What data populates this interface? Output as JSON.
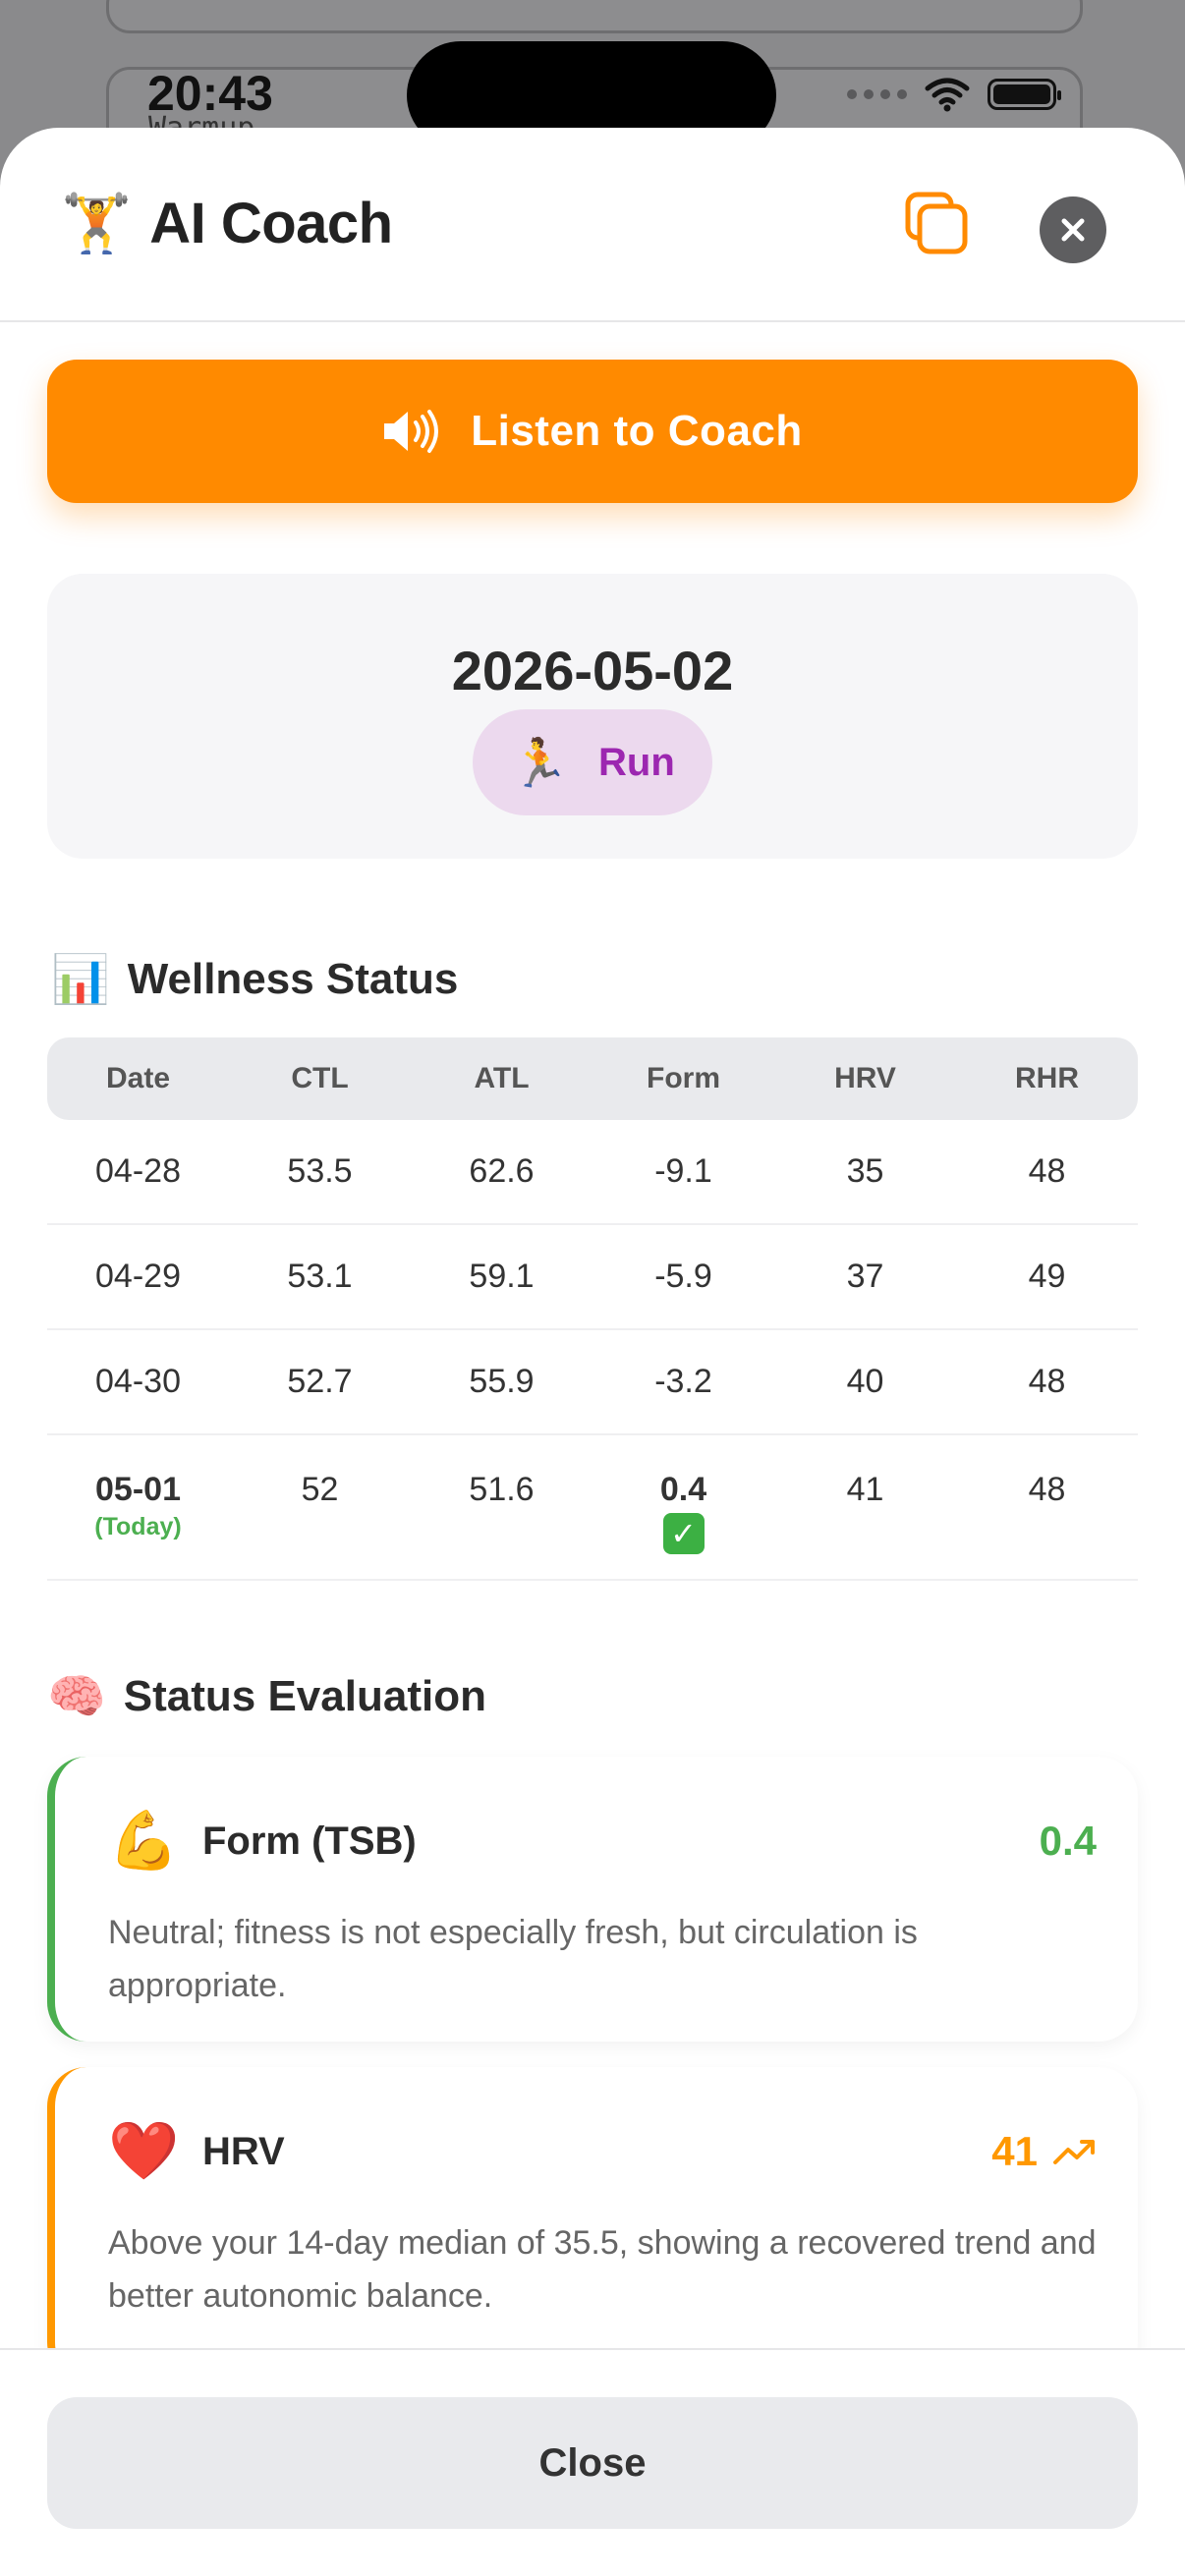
{
  "status_bar": {
    "time": "20:43"
  },
  "background": {
    "card_text": "Warmup"
  },
  "header": {
    "emoji": "🏋️",
    "title": "AI Coach"
  },
  "listen_button": {
    "label": "Listen to Coach"
  },
  "date_card": {
    "date": "2026-05-02",
    "sport_emoji": "🏃",
    "sport": "Run"
  },
  "wellness": {
    "title_emoji": "📊",
    "title": "Wellness Status",
    "columns": [
      "Date",
      "CTL",
      "ATL",
      "Form",
      "HRV",
      "RHR"
    ],
    "rows": [
      {
        "date": "04-28",
        "ctl": "53.5",
        "atl": "62.6",
        "form": "-9.1",
        "hrv": "35",
        "rhr": "48"
      },
      {
        "date": "04-29",
        "ctl": "53.1",
        "atl": "59.1",
        "form": "-5.9",
        "hrv": "37",
        "rhr": "49"
      },
      {
        "date": "04-30",
        "ctl": "52.7",
        "atl": "55.9",
        "form": "-3.2",
        "hrv": "40",
        "rhr": "48"
      }
    ],
    "today": {
      "date": "05-01",
      "label": "(Today)",
      "ctl": "52",
      "atl": "51.6",
      "form": "0.4",
      "hrv": "41",
      "rhr": "48"
    }
  },
  "evaluation": {
    "title_emoji": "🧠",
    "title": "Status Evaluation",
    "items": [
      {
        "emoji": "💪",
        "name": "Form (TSB)",
        "value": "0.4",
        "color": "#4caf50",
        "desc": "Neutral; fitness is not especially fresh, but circulation is appropriate."
      },
      {
        "emoji": "❤️",
        "name": "HRV",
        "value": "41",
        "color": "#ff9800",
        "desc": "Above your 14-day median of 35.5, showing a recovered trend and better autonomic balance."
      }
    ]
  },
  "footer": {
    "close_label": "Close"
  },
  "colors": {
    "accent": "#ff8a00",
    "good": "#4caf50",
    "warn": "#ff9800",
    "sport": "#9c27b0"
  }
}
